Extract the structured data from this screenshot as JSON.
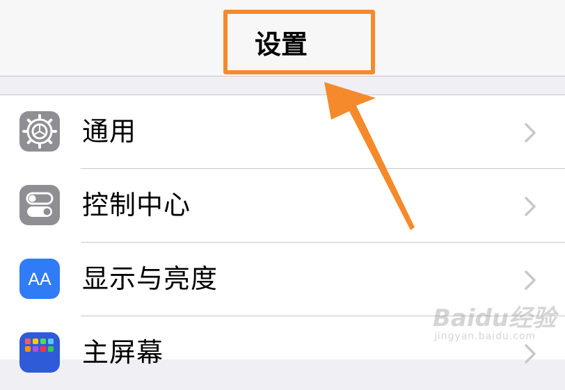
{
  "nav": {
    "title": "设置"
  },
  "rows": [
    {
      "label": "通用",
      "icon": "gear-icon",
      "icon_color": "#8e8e93"
    },
    {
      "label": "控制中心",
      "icon": "toggle-switches-icon",
      "icon_color": "#8e8e93"
    },
    {
      "label": "显示与亮度",
      "icon": "text-size-icon",
      "icon_color": "#2f7cf6",
      "icon_text": "AA"
    },
    {
      "label": "主屏幕",
      "icon": "app-grid-icon",
      "icon_color": "#2f5bd8"
    }
  ],
  "annotation": {
    "color": "#f58a2c"
  },
  "watermark": {
    "logo": "Baidu经验",
    "url": "jingyan.baidu.com"
  }
}
